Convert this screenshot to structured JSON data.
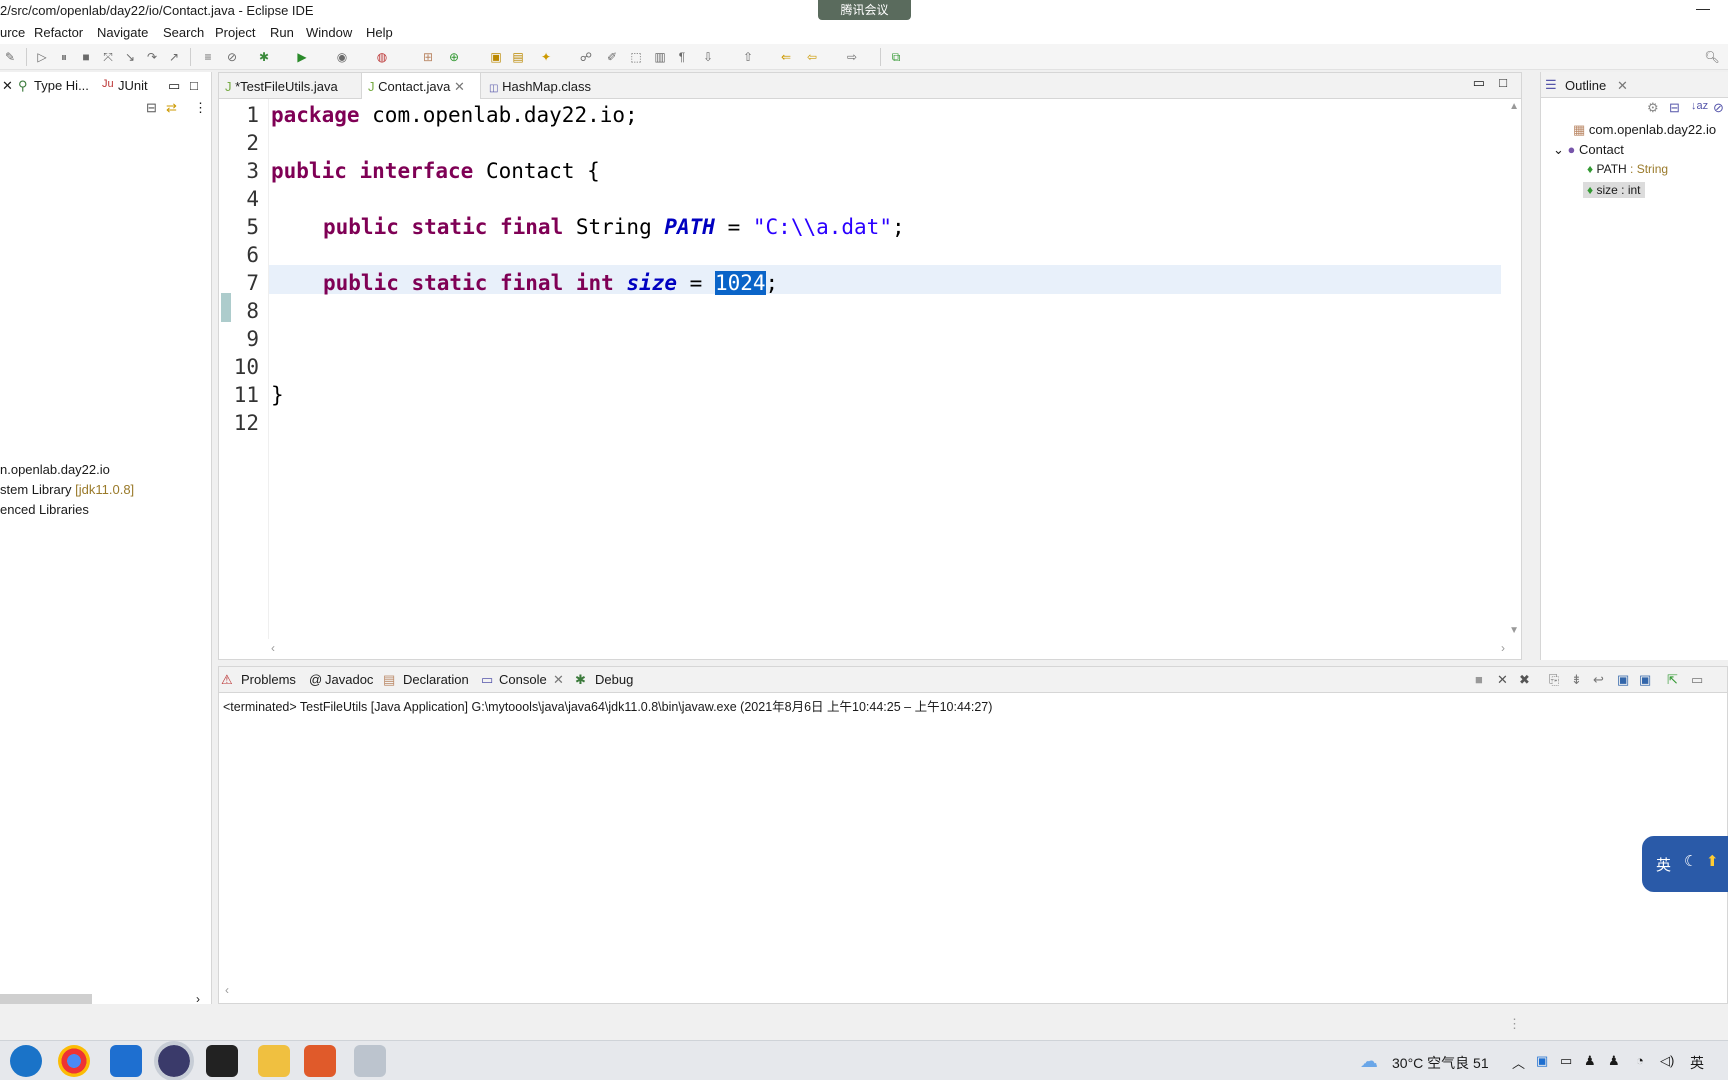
{
  "window": {
    "title": "2/src/com/openlab/day22/io/Contact.java - Eclipse IDE",
    "meeting_badge": "腾讯会议"
  },
  "menu": [
    "urce",
    "Refactor",
    "Navigate",
    "Search",
    "Project",
    "Run",
    "Window",
    "Help"
  ],
  "left_panel": {
    "tabs": [
      "Type Hi...",
      "JUnit"
    ],
    "tree": [
      {
        "label": "n.openlab.day22.io",
        "extra": ""
      },
      {
        "label": "stem Library ",
        "extra": "[jdk11.0.8]"
      },
      {
        "label": "enced Libraries",
        "extra": ""
      }
    ]
  },
  "editor": {
    "tabs": [
      "*TestFileUtils.java",
      "Contact.java",
      "HashMap.class"
    ],
    "line_numbers": [
      "1",
      "2",
      "3",
      "4",
      "5",
      "6",
      "7",
      "8",
      "9",
      "10",
      "11",
      "12"
    ],
    "code": {
      "l1_kw": "package",
      "l1_rest": " com.openlab.day22.io;",
      "l3_kw1": "public",
      "l3_kw2": "interface",
      "l3_rest": " Contact {",
      "l5_kw": "public static final",
      "l5_type": " String ",
      "l5_field": "PATH",
      "l5_eq": " = ",
      "l5_str": "\"C:\\\\a.dat\"",
      "l5_end": ";",
      "l7_kw": "public static final int",
      "l7_field": "size",
      "l7_eq": " = ",
      "l7_val": "1024",
      "l7_end": ";",
      "l11": "}"
    }
  },
  "outline": {
    "tab": "Outline",
    "package": "com.openlab.day22.io",
    "type": "Contact",
    "fields": [
      {
        "name": "PATH",
        "type": " : String"
      },
      {
        "name": "size",
        "type": " : int"
      }
    ]
  },
  "bottom": {
    "tabs": [
      "Problems",
      "Javadoc",
      "Declaration",
      "Console",
      "Debug"
    ],
    "console_line": "<terminated> TestFileUtils [Java Application] G:\\mytoools\\java\\java64\\jdk11.0.8\\bin\\javaw.exe  (2021年8月6日 上午10:44:25 – 上午10:44:27)"
  },
  "ime": {
    "label": "英"
  },
  "taskbar": {
    "weather": "30°C 空气良 51",
    "lang": "英"
  }
}
